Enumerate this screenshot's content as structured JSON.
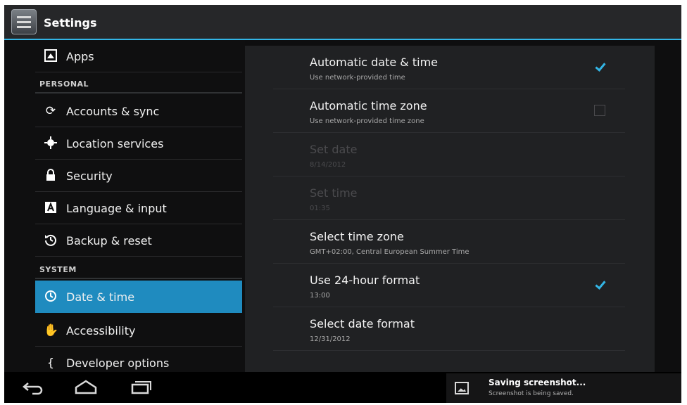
{
  "action_bar": {
    "title": "Settings",
    "icon": "settings-icon"
  },
  "sidebar": {
    "sections": {
      "personal": "PERSONAL",
      "system": "SYSTEM"
    },
    "items": [
      {
        "label": "Apps",
        "icon": "apps-icon"
      },
      {
        "label": "Accounts & sync",
        "icon": "sync-icon"
      },
      {
        "label": "Location services",
        "icon": "location-icon"
      },
      {
        "label": "Security",
        "icon": "lock-icon"
      },
      {
        "label": "Language & input",
        "icon": "language-icon"
      },
      {
        "label": "Backup & reset",
        "icon": "backup-icon"
      },
      {
        "label": "Date & time",
        "icon": "clock-icon",
        "selected": true
      },
      {
        "label": "Accessibility",
        "icon": "hand-icon"
      },
      {
        "label": "Developer options",
        "icon": "braces-icon"
      }
    ]
  },
  "preferences": [
    {
      "title": "Automatic date & time",
      "summary": "Use network-provided time",
      "checkbox": "checked"
    },
    {
      "title": "Automatic time zone",
      "summary": "Use network-provided time zone",
      "checkbox": "unchecked"
    },
    {
      "title": "Set date",
      "summary": "8/14/2012",
      "disabled": true
    },
    {
      "title": "Set time",
      "summary": "01:35",
      "disabled": true
    },
    {
      "title": "Select time zone",
      "summary": "GMT+02:00, Central European Summer Time"
    },
    {
      "title": "Use 24-hour format",
      "summary": "13:00",
      "checkbox": "checked"
    },
    {
      "title": "Select date format",
      "summary": "12/31/2012"
    }
  ],
  "navigation": {
    "back": "back-icon",
    "home": "home-icon",
    "recents": "recents-icon"
  },
  "notification": {
    "title": "Saving screenshot...",
    "subtitle": "Screenshot is being saved.",
    "icon": "image-icon"
  },
  "colors": {
    "accent": "#33b5e5",
    "selected": "#1f8bbf",
    "background": "#0e0e0f",
    "pane": "#202123"
  }
}
